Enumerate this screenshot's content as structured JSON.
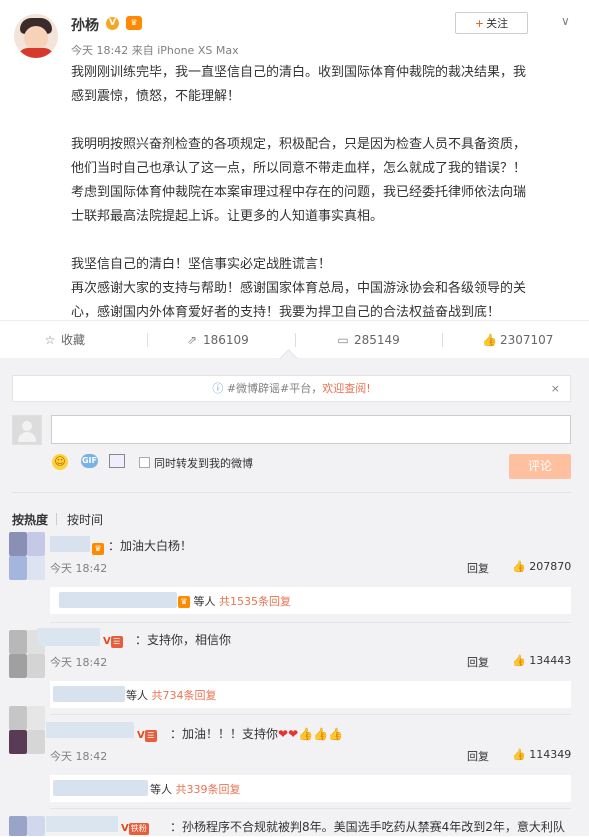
{
  "post": {
    "author": "孙杨",
    "verified_icon": "v-badge",
    "member_icon": "crown-badge",
    "time": "今天 18:42",
    "source": "来自 iPhone XS Max",
    "follow_plus": "+",
    "follow_label": "关注",
    "menu_glyph": "∨",
    "paragraphs": [
      [
        "我刚刚训练完毕，我一直坚信自己的清白。收到国际体育仲裁院的裁决结果，我",
        "感到震惊，愤怒，不能理解！"
      ],
      [
        "我明明按照兴奋剂检查的各项规定，积极配合，只是因为检查人员不具备资质，",
        "他们当时自己也承认了这一点，所以同意不带走血样，怎么就成了我的错误？！",
        "考虑到国际体育仲裁院在本案审理过程中存在的问题，我已经委托律师依法向瑞",
        "士联邦最高法院提起上诉。让更多的人知道事实真相。"
      ],
      [
        "我坚信自己的清白！坚信事实必定战胜谎言！",
        "再次感谢大家的支持与帮助！感谢国家体育总局，中国游泳协会和各级领导的关",
        "心，感谢国内外体育爱好者的支持！我要为捍卫自己的合法权益奋战到底！"
      ]
    ]
  },
  "actions": {
    "favorite": "收藏",
    "repost": "186109",
    "comment": "285149",
    "like": "2307107"
  },
  "notice": {
    "prefix": "#微博辟谣#平台",
    "sep": "，",
    "link": "欢迎查阅!",
    "close": "×"
  },
  "composer": {
    "repost_checkbox_label": "同时转发到我的微博",
    "submit": "评论"
  },
  "sort": {
    "hot": "按热度",
    "time": "按时间"
  },
  "comments": [
    {
      "text": "：加油大白杨！",
      "time": "今天 18:42",
      "reply": "回复",
      "likes": "207870",
      "sub_prefix": "等人",
      "sub_link": "共1535条回复"
    },
    {
      "text": "：支持你，相信你",
      "time": "今天 18:42",
      "reply": "回复",
      "likes": "134443",
      "sub_prefix": "等人",
      "sub_link": "共734条回复"
    },
    {
      "text": "：加油！！！支持你",
      "time": "今天 18:42",
      "reply": "回复",
      "likes": "114349",
      "sub_prefix": "等人",
      "sub_link": "共339条回复"
    },
    {
      "text": "：孙杨程序不合规就被判8年。美国选手吃药从禁赛4年改到2年，意大利队"
    }
  ],
  "colors": {
    "accent": "#eb7350",
    "submit_bg": "#ffc09f",
    "panel_bg": "#f2f2f5"
  }
}
